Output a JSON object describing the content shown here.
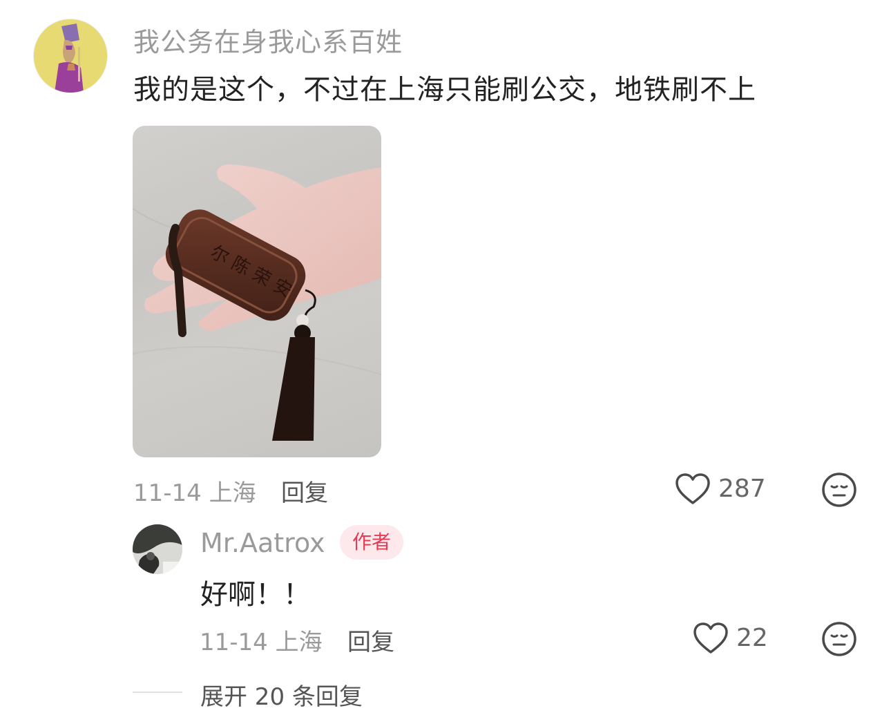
{
  "main_comment": {
    "username": "我公务在身我心系百姓",
    "text": "我的是这个，不过在上海只能刷公交，地铁刷不上",
    "date": "11-14",
    "location": "上海",
    "reply_label": "回复",
    "like_count": "287",
    "like_icon": "heart-outline-icon",
    "dislike_icon": "meh-face-icon"
  },
  "reply": {
    "username": "Mr.Aatrox",
    "badge": "作者",
    "text": "好啊！！",
    "date": "11-14",
    "location": "上海",
    "reply_label": "回复",
    "like_count": "22"
  },
  "expand_replies": "展开 20 条回复",
  "colors": {
    "badge_bg": "#fde9ec",
    "badge_text": "#e53a55",
    "meta_gray": "#9a9a9a"
  }
}
